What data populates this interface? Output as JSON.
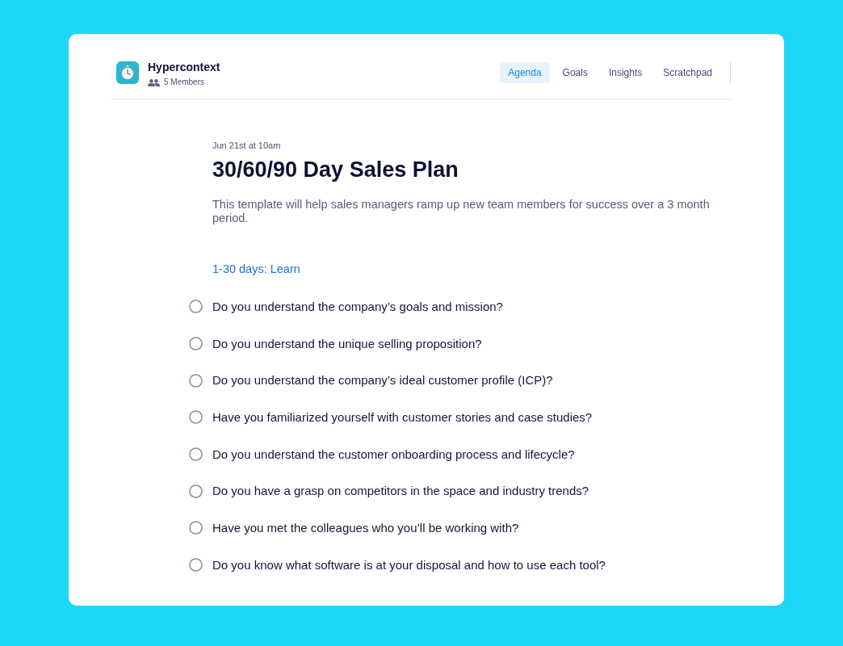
{
  "header": {
    "app_name": "Hypercontext",
    "members": "5 Members"
  },
  "tabs": [
    {
      "label": "Agenda",
      "selected": true
    },
    {
      "label": "Goals",
      "selected": false
    },
    {
      "label": "Insights",
      "selected": false
    },
    {
      "label": "Scratchpad",
      "selected": false
    }
  ],
  "meeting": {
    "date": "Jun 21st at 10am",
    "title": "30/60/90 Day Sales Plan",
    "description": "This template will help sales managers ramp up new team members for success over a 3 month period."
  },
  "section": {
    "heading": "1-30 days: Learn",
    "items": [
      {
        "text": "Do you understand the company’s goals and mission?",
        "checked": false
      },
      {
        "text": "Do you understand the unique selling proposition?",
        "checked": false
      },
      {
        "text": "Do you understand the company’s ideal customer profile (ICP)?",
        "checked": false
      },
      {
        "text": "Have you familiarized yourself with customer stories and case studies?",
        "checked": false
      },
      {
        "text": "Do you understand the customer onboarding process and lifecycle?",
        "checked": false
      },
      {
        "text": "Do you have a grasp on competitors in the space and industry trends?",
        "checked": false
      },
      {
        "text": "Have you met the colleagues who you’ll be working with?",
        "checked": false
      },
      {
        "text": "Do you know what software is at your disposal and how to use each tool?",
        "checked": false
      }
    ]
  }
}
